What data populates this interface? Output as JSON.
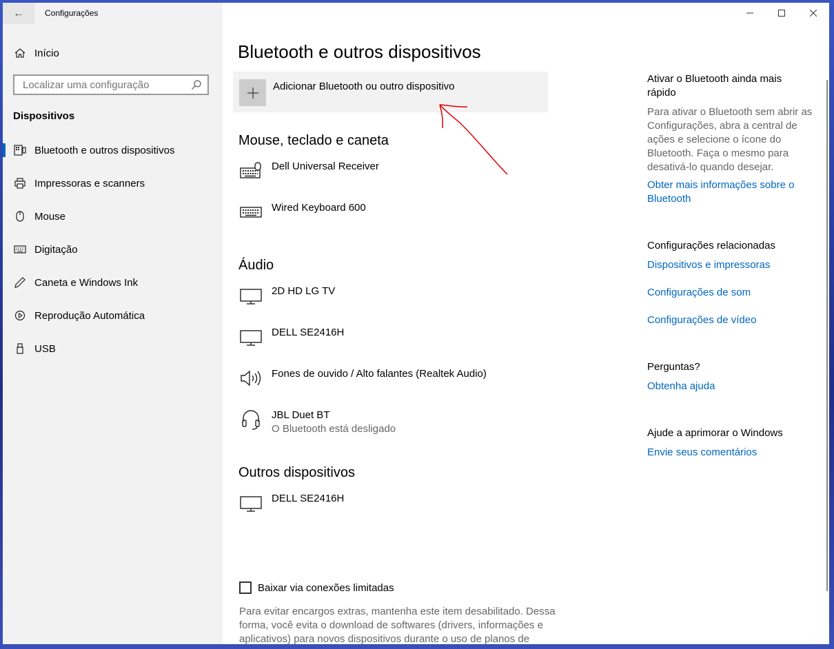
{
  "app": {
    "title": "Configurações",
    "back_label": "←"
  },
  "sidebar": {
    "home_label": "Início",
    "search_placeholder": "Localizar uma configuração",
    "section_label": "Dispositivos",
    "items": [
      {
        "label": "Bluetooth e outros dispositivos",
        "icon": "bluetooth-devices-icon",
        "active": true
      },
      {
        "label": "Impressoras e scanners",
        "icon": "printer-icon"
      },
      {
        "label": "Mouse",
        "icon": "mouse-icon"
      },
      {
        "label": "Digitação",
        "icon": "keyboard-icon"
      },
      {
        "label": "Caneta e Windows Ink",
        "icon": "pen-icon"
      },
      {
        "label": "Reprodução Automática",
        "icon": "autoplay-icon"
      },
      {
        "label": "USB",
        "icon": "usb-icon"
      }
    ]
  },
  "main": {
    "title": "Bluetooth e outros dispositivos",
    "add_device_label": "Adicionar Bluetooth ou outro dispositivo",
    "groups": {
      "input": {
        "title": "Mouse, teclado e caneta",
        "devices": [
          {
            "name": "Dell Universal Receiver",
            "icon": "keyboard-mouse-icon"
          },
          {
            "name": "Wired Keyboard 600",
            "icon": "keyboard-icon"
          }
        ]
      },
      "audio": {
        "title": "Áudio",
        "devices": [
          {
            "name": "2D HD LG TV",
            "icon": "monitor-icon"
          },
          {
            "name": "DELL SE2416H",
            "icon": "monitor-icon"
          },
          {
            "name": "Fones de ouvido / Alto falantes (Realtek Audio)",
            "icon": "speaker-icon"
          },
          {
            "name": "JBL Duet BT",
            "status": "O Bluetooth está desligado",
            "icon": "headset-icon"
          }
        ]
      },
      "other": {
        "title": "Outros dispositivos",
        "devices": [
          {
            "name": "DELL SE2416H",
            "icon": "monitor-icon"
          }
        ]
      }
    },
    "metered_checkbox": {
      "label": "Baixar via conexões limitadas",
      "checked": false,
      "description": "Para evitar encargos extras, mantenha este item desabilitado. Dessa forma, você evita o download de softwares (drivers, informações e aplicativos) para novos dispositivos durante o uso de planos de"
    }
  },
  "side_panel": {
    "quick_title": "Ativar o Bluetooth ainda mais rápido",
    "quick_text": "Para ativar o Bluetooth sem abrir as Configurações, abra a central de ações e selecione o ícone do Bluetooth. Faça o mesmo para desativá-lo quando desejar.",
    "quick_link": "Obter mais informações sobre o Bluetooth",
    "related_title": "Configurações relacionadas",
    "related_links": [
      "Dispositivos e impressoras",
      "Configurações de som",
      "Configurações de vídeo"
    ],
    "questions_title": "Perguntas?",
    "help_link": "Obtenha ajuda",
    "improve_title": "Ajude a aprimorar o Windows",
    "feedback_link": "Envie seus comentários"
  },
  "colors": {
    "accent": "#0067c0",
    "sidebar_bg": "#f2f2f2",
    "annotation": "#e00000"
  }
}
